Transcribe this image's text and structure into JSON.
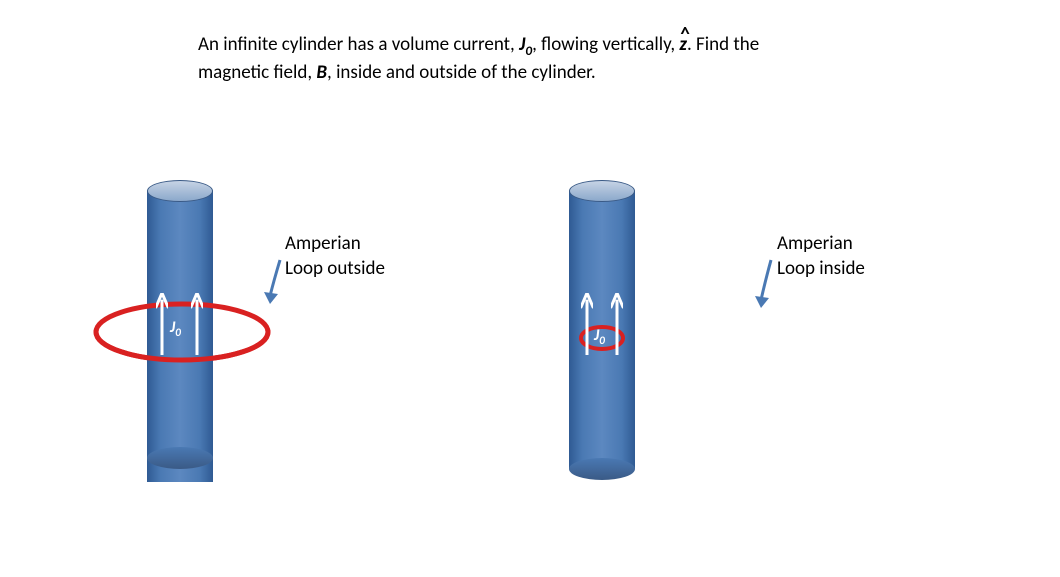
{
  "problem": {
    "line1_pre": "An infinite cylinder has a volume current, ",
    "J0": "J",
    "J0_sub": "0",
    "line1_mid": ", flowing vertically, ",
    "zhat": "z",
    "line1_post": ".  Find the",
    "line2_pre": "magnetic field, ",
    "B": "B",
    "line2_post": ", inside and outside of the cylinder."
  },
  "labels": {
    "left_label_l1": "Amperian",
    "left_label_l2": "Loop outside",
    "right_label_l1": "Amperian",
    "right_label_l2": "Loop inside",
    "J0_text": "J",
    "J0_sub": "0"
  },
  "colors": {
    "loop": "#d92121",
    "cyl": "#4a79b3",
    "arrow_white": "#ffffff",
    "pointer_blue": "#4a79b3"
  }
}
